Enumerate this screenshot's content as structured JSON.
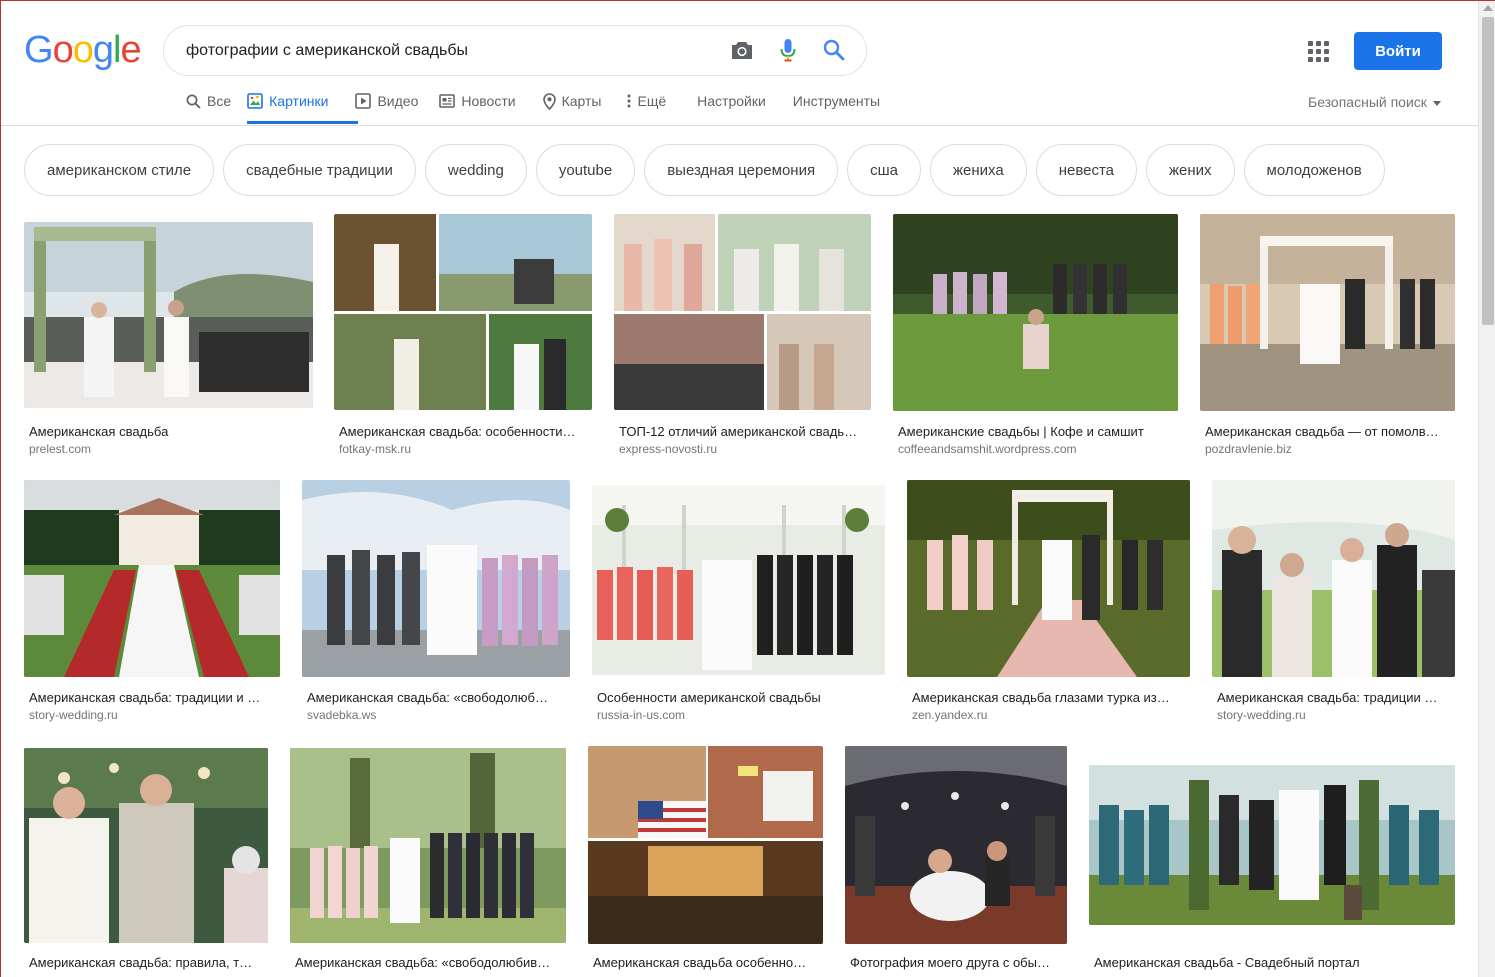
{
  "colors": {
    "google_blue": "#4285F4",
    "google_red": "#EA4335",
    "google_yellow": "#FBBC05",
    "google_green": "#34A853",
    "accent": "#1a73e8"
  },
  "header": {
    "logo": {
      "g1": "G",
      "o1": "o",
      "o2": "o",
      "g2": "g",
      "l": "l",
      "e": "e"
    },
    "search": {
      "value": "фотографии с американской свадьбы",
      "icons": [
        "camera-icon",
        "microphone-icon",
        "search-icon"
      ]
    },
    "apps_icon": "apps-grid-icon",
    "signin_label": "Войти"
  },
  "tabs": [
    {
      "label": "Все",
      "icon": "search-icon",
      "active": false
    },
    {
      "label": "Картинки",
      "icon": "image-icon",
      "active": true
    },
    {
      "label": "Видео",
      "icon": "video-icon",
      "active": false
    },
    {
      "label": "Новости",
      "icon": "news-icon",
      "active": false
    },
    {
      "label": "Карты",
      "icon": "map-pin-icon",
      "active": false
    },
    {
      "label": "Ещё",
      "icon": "more-vert-icon",
      "active": false
    },
    {
      "label": "Настройки",
      "icon": "",
      "active": false
    },
    {
      "label": "Инструменты",
      "icon": "",
      "active": false
    }
  ],
  "safe_search": "Безопасный поиск",
  "chips": [
    "американском стиле",
    "свадебные традиции",
    "wedding",
    "youtube",
    "выездная церемония",
    "сша",
    "жениха",
    "невеста",
    "жених",
    "молодоженов"
  ],
  "results": [
    {
      "caption": "Американская свадьба",
      "source": "prelest.com"
    },
    {
      "caption": "Американская свадьба: особенности…",
      "source": "fotkay-msk.ru"
    },
    {
      "caption": "ТОП-12 отличий американской свадь…",
      "source": "express-novosti.ru"
    },
    {
      "caption": "Американские свадьбы | Кофе и самшит",
      "source": "coffeeandsamshit.wordpress.com"
    },
    {
      "caption": "Американская свадьба — от помолв…",
      "source": "pozdravlenie.biz"
    },
    {
      "caption": "Американская свадьба: традиции и …",
      "source": "story-wedding.ru"
    },
    {
      "caption": "Американская свадьба: «свободолюб…",
      "source": "svadebka.ws"
    },
    {
      "caption": "Особенности американской свадьбы",
      "source": "russia-in-us.com"
    },
    {
      "caption": "Американская свадьба глазами турка из…",
      "source": "zen.yandex.ru"
    },
    {
      "caption": "Американская свадьба: традиции …",
      "source": "story-wedding.ru"
    },
    {
      "caption": "Американская свадьба: правила, т…",
      "source": ""
    },
    {
      "caption": "Американская свадьба: «свободолюбив…",
      "source": ""
    },
    {
      "caption": "Американская свадьба особенно…",
      "source": ""
    },
    {
      "caption": "Фотография моего друга с обы…",
      "source": ""
    },
    {
      "caption": "Американская свадьба - Свадебный портал",
      "source": ""
    }
  ]
}
